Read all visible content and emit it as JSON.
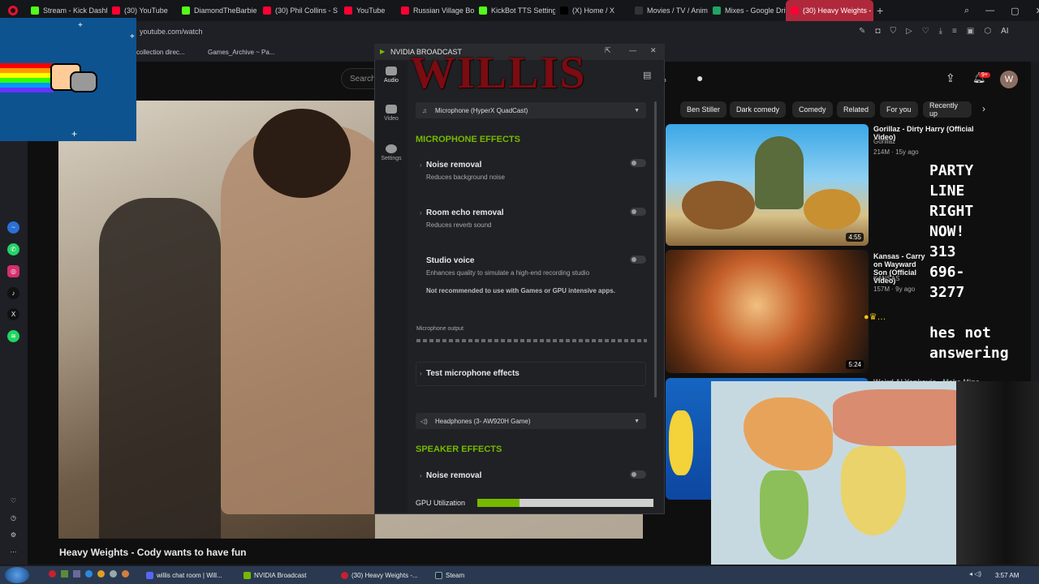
{
  "browser": {
    "tabs": [
      {
        "label": "Stream - Kick Dashboa",
        "color": "#53fc18"
      },
      {
        "label": "(30) YouTube",
        "color": "#ff0033"
      },
      {
        "label": "DiamondTheBarbie Str",
        "color": "#53fc18"
      },
      {
        "label": "(30) Phil Collins - S",
        "color": "#ff0033"
      },
      {
        "label": "YouTube",
        "color": "#ff0033"
      },
      {
        "label": "Russian Village Boys",
        "color": "#ff0033"
      },
      {
        "label": "KickBot TTS Settings",
        "color": "#53fc18"
      },
      {
        "label": "(X) Home / X",
        "color": "#000000"
      },
      {
        "label": "Movies / TV / Anime",
        "color": "#333333"
      },
      {
        "label": "Mixes - Google Drive",
        "color": "#1fa463"
      },
      {
        "label": "(30) Heavy Weights - Coo",
        "color": "#ff0033"
      }
    ],
    "url": "youtube.com/watch",
    "bookmarks": [
      "collection direc...",
      "Games_Archive ~ Pa..."
    ]
  },
  "youtube": {
    "search_placeholder": "Search",
    "notification_count": "9+",
    "avatar_letter": "W",
    "chips": [
      "Ben Stiller",
      "Dark comedy",
      "Comedy",
      "Related",
      "For you",
      "Recently up"
    ],
    "video_title": "Heavy Weights - Cody wants to have fun",
    "recommendations": [
      {
        "title": "Gorillaz - Dirty Harry (Official Video)",
        "channel": "Gorillaz",
        "meta": "214M · 15y ago",
        "duration": "4:55"
      },
      {
        "title": "Kansas - Carry on Wayward Son (Official Video)",
        "channel": "KANSAS",
        "meta": "157M · 9y ago",
        "duration": "5:24"
      }
    ],
    "next_title": "Weird Al Yankovic - Make Mine Music"
  },
  "overlay": {
    "party_text": "PARTY\nLINE\nRIGHT\nNOW!\n313\n696-\n3277\n\nhes not\nanswering"
  },
  "nvidia": {
    "title": "NVIDIA BROADCAST",
    "overlay_logo": "WILLIS",
    "nav": [
      "Audio",
      "Video",
      "Settings"
    ],
    "mic_device": "Microphone (HyperX QuadCast)",
    "mic_section": "MICROPHONE EFFECTS",
    "effects": [
      {
        "name": "Noise removal",
        "desc": "Reduces background noise"
      },
      {
        "name": "Room echo removal",
        "desc": "Reduces reverb sound"
      },
      {
        "name": "Studio voice",
        "desc": "Enhances quality to simulate a high-end recording studio",
        "note": "Not recommended to use with Games or GPU intensive apps."
      }
    ],
    "mic_output_label": "Microphone output",
    "test_label": "Test microphone effects",
    "speaker_device": "Headphones (3- AW920H Game)",
    "speaker_section": "SPEAKER EFFECTS",
    "speaker_effect": "Noise removal",
    "gpu_label": "GPU Utilization",
    "gpu_utilization": 0.24,
    "accent": "#76b900"
  },
  "taskbar": {
    "items": [
      "willis chat room | Will...",
      "NVIDIA Broadcast",
      "(30) Heavy Weights -...",
      "Steam"
    ],
    "clock": "3:57 AM"
  }
}
